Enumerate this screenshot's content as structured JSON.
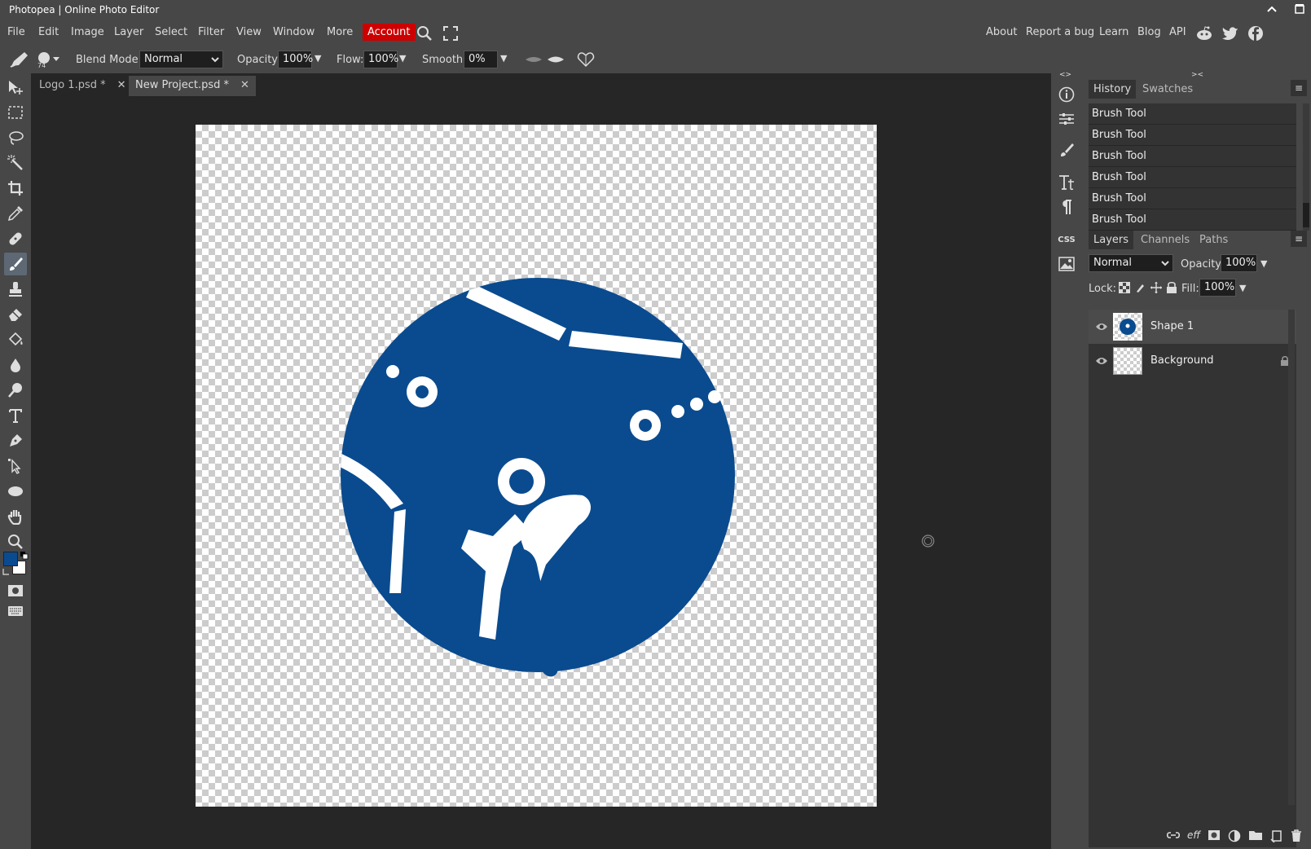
{
  "window": {
    "title": "Photopea | Online Photo Editor"
  },
  "menu": {
    "items": [
      "File",
      "Edit",
      "Image",
      "Layer",
      "Select",
      "Filter",
      "View",
      "Window",
      "More"
    ],
    "account": "Account",
    "right_links": [
      "About",
      "Report a bug",
      "Learn",
      "Blog",
      "API"
    ]
  },
  "options": {
    "brush_size": "74",
    "blend_mode_label": "Blend Mode:",
    "blend_mode": "Normal",
    "opacity_label": "Opacity:",
    "opacity": "100%",
    "flow_label": "Flow:",
    "flow": "100%",
    "smooth_label": "Smooth:",
    "smooth": "0%"
  },
  "documents": [
    {
      "name": "Logo 1.psd *",
      "active": false
    },
    {
      "name": "New Project.psd *",
      "active": true
    }
  ],
  "colors": {
    "foreground": "#0a4b8f",
    "background": "#ffffff",
    "accent": "#cc0000"
  },
  "history_panel": {
    "tabs": [
      "History",
      "Swatches"
    ],
    "items": [
      "Brush Tool",
      "Brush Tool",
      "Brush Tool",
      "Brush Tool",
      "Brush Tool",
      "Brush Tool"
    ]
  },
  "layers_panel": {
    "tabs": [
      "Layers",
      "Channels",
      "Paths"
    ],
    "blend_mode": "Normal",
    "opacity_label": "Opacity:",
    "opacity": "100%",
    "lock_label": "Lock:",
    "fill_label": "Fill:",
    "fill": "100%",
    "layers": [
      {
        "name": "Shape 1",
        "selected": true,
        "locked": false
      },
      {
        "name": "Background",
        "selected": false,
        "locked": true
      }
    ]
  },
  "icon_strip": {
    "css_label": "CSS"
  }
}
